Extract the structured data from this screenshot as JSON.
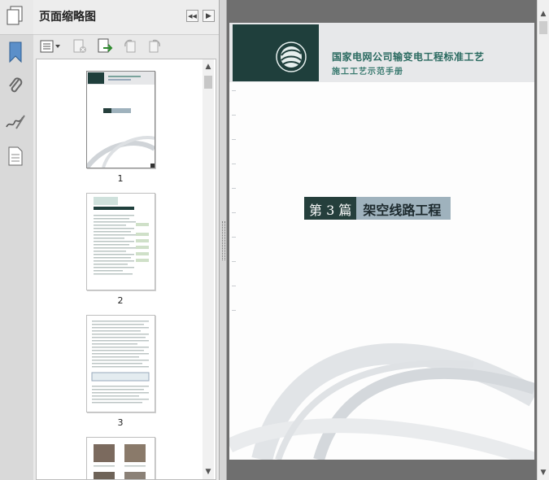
{
  "panel": {
    "title": "页面缩略图",
    "nav_prev_glyph": "◀◀",
    "nav_next_glyph": "▶"
  },
  "icons": {
    "pages": "pages-icon",
    "bookmark": "bookmark-icon",
    "attachment": "paperclip-icon",
    "signature": "signature-icon",
    "layers": "document-icon"
  },
  "thumbnails": [
    {
      "page": "1"
    },
    {
      "page": "2"
    },
    {
      "page": "3"
    }
  ],
  "document": {
    "header_title": "国家电网公司输变电工程标准工艺",
    "header_subtitle": "施工工艺示范手册",
    "chapter_number": "第 3 篇",
    "chapter_name": "架空线路工程"
  },
  "colors": {
    "accent_dark": "#253f3c",
    "accent_light": "#9fb2bd",
    "header_text": "#2a6a60"
  }
}
